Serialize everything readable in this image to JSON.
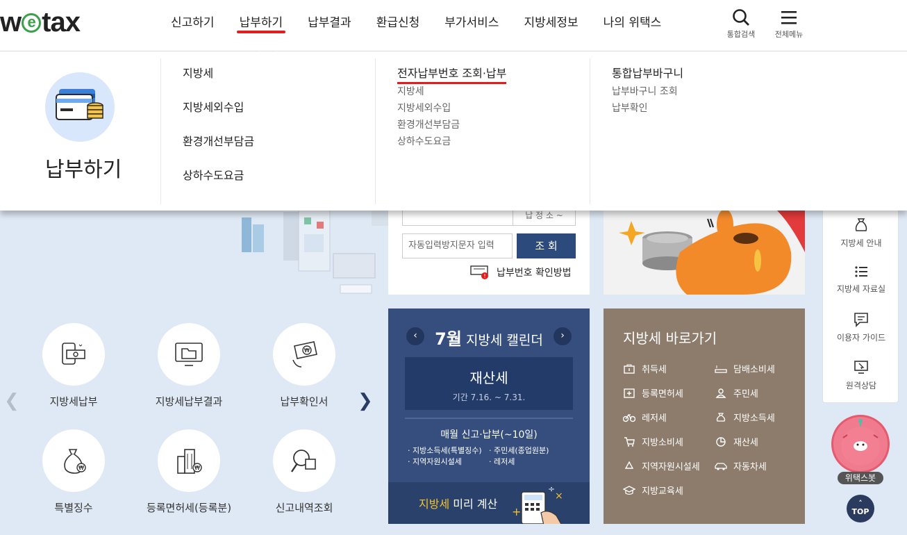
{
  "header": {
    "logo": "wetax",
    "nav": [
      "신고하기",
      "납부하기",
      "납부결과",
      "환급신청",
      "부가서비스",
      "지방세정보",
      "나의 위택스"
    ],
    "active_nav": "납부하기",
    "search_label": "통합검색",
    "menu_label": "전체메뉴"
  },
  "mega": {
    "title": "납부하기",
    "col1": [
      "지방세",
      "지방세외수입",
      "환경개선부담금",
      "상하수도요금"
    ],
    "col2": {
      "title": "전자납부번호 조회·납부",
      "items": [
        "지방세",
        "지방세외수입",
        "환경개선부담금",
        "상하수도요금"
      ]
    },
    "col3": {
      "title": "통합납부바구니",
      "items": [
        "납부바구니 조회",
        "납부확인"
      ]
    }
  },
  "search": {
    "top_button_partial": "납 정 소 ~",
    "captcha_placeholder": "자동입력방지문자 입력",
    "submit": "조 회",
    "help": "납부번호 확인방법"
  },
  "quick": [
    "지방세납부",
    "지방세납부결과",
    "납부확인서",
    "특별징수",
    "등록면허세(등록분)",
    "신고내역조회"
  ],
  "calendar": {
    "month": "7월",
    "title": "지방세 캘린더",
    "tax": "재산세",
    "period": "기간 7.16. ~ 7.31.",
    "monthly": "매월 신고·납부(~10일)",
    "list_left": [
      "· 지방소득세(특별징수)",
      "· 지역자원시설세"
    ],
    "list_right": [
      "· 주민세(종업원분)",
      "· 레저세"
    ],
    "calc_highlight": "지방세",
    "calc_rest": " 미리 계산"
  },
  "shortcuts": {
    "title": "지방세 바로가기",
    "left": [
      "취득세",
      "등록면허세",
      "레저세",
      "지방소비세",
      "지역자원시설세",
      "지방교육세"
    ],
    "right": [
      "담배소비세",
      "주민세",
      "지방소득세",
      "재산세",
      "자동차세"
    ]
  },
  "side": {
    "items": [
      "지방세 안내",
      "지방세 자료실",
      "이용자 가이드",
      "원격상담"
    ],
    "bot_label": "위택스봇",
    "top": "TOP"
  },
  "colors": {
    "accent_red": "#e01e1e",
    "navy": "#2c4a7c",
    "calendar_bg": "#354e7d",
    "shortcut_bg": "#8d7c6c"
  }
}
